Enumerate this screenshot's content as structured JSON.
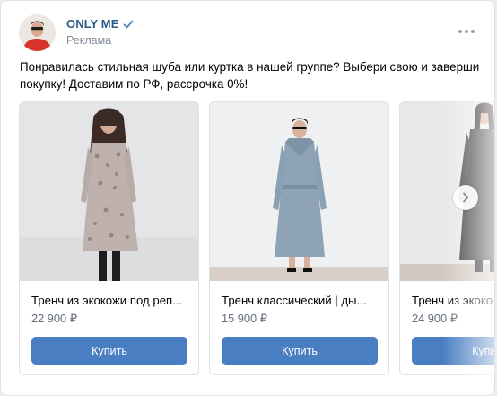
{
  "post": {
    "author_name": "ONLY ME",
    "ad_label": "Реклама",
    "text": "Понравилась стильная шуба или куртка в нашей группе? Выбери свою и заверши покупку! Доставим по РФ, рассрочка 0%!"
  },
  "products": [
    {
      "title": "Тренч из экокожи под реп...",
      "price": "22 900 ₽",
      "button": "Купить"
    },
    {
      "title": "Тренч классический | ды...",
      "price": "15 900 ₽",
      "button": "Купить"
    },
    {
      "title": "Тренч из экоко",
      "price": "24 900 ₽",
      "button": "Купить"
    }
  ],
  "colors": {
    "author": "#2a5885",
    "button": "#4a7ec2",
    "muted": "#818c99"
  },
  "icons": {
    "verified": "verified-check-icon",
    "more": "more-dots-icon",
    "next": "chevron-right-icon"
  }
}
